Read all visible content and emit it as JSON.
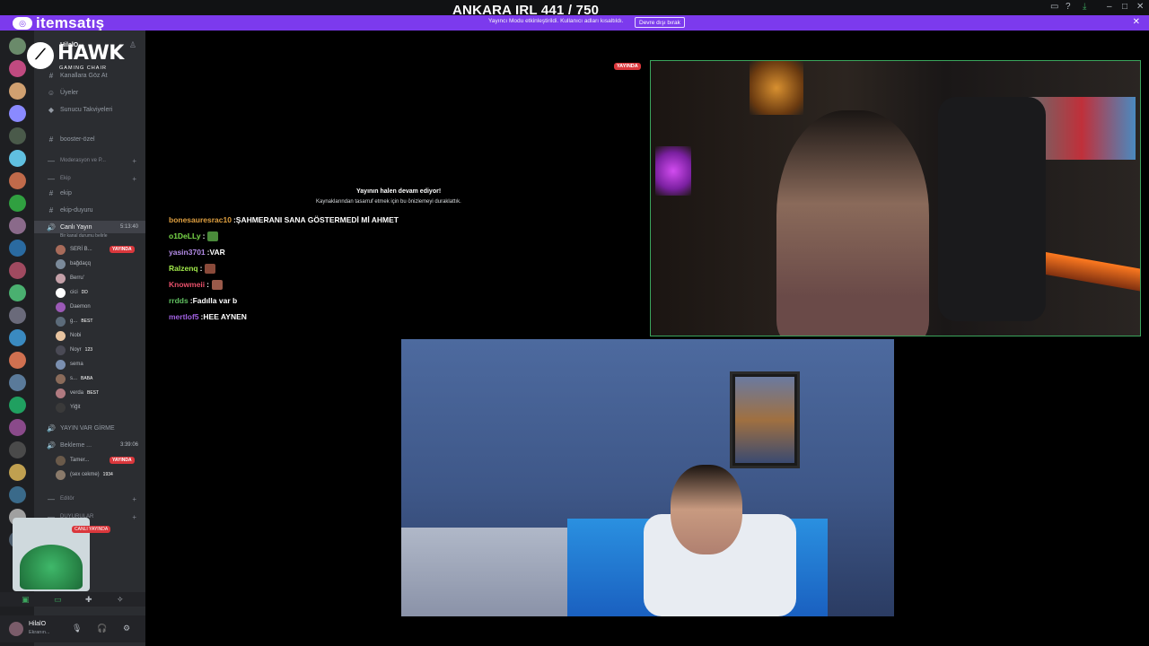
{
  "window": {
    "overlay_title": "ANKARA IRL 441 / 750"
  },
  "brand": {
    "name": "itemsatış"
  },
  "notice": {
    "text": "Yayıncı Modu etkinleştirildi. Kullanıcı adları kısaltıldı.",
    "disable_button": "Devre dışı bırak"
  },
  "sponsor": {
    "word": "HAWK",
    "sub": "GAMING CHAIR"
  },
  "sidebar": {
    "server_name": "HilalO ⌄",
    "items": [
      {
        "icon": "#",
        "label": "Kanallara Göz At"
      },
      {
        "icon": "👥",
        "label": "Üyeler"
      },
      {
        "icon": "◆",
        "label": "Sunucu Takviyeleri"
      },
      {
        "icon": "#",
        "label": "booster-özel"
      }
    ],
    "categories": [
      {
        "label": "Moderasyon ve P..."
      },
      {
        "label": "Ekip"
      }
    ],
    "channels": [
      {
        "icon": "#",
        "label": "ekip"
      },
      {
        "icon": "#",
        "label": "ekip-duyuru"
      }
    ],
    "voice_live": {
      "label": "Canlı Yayın",
      "time": "5:13:40",
      "subtitle": "Bir kanal durumu belirle"
    },
    "members_live": [
      {
        "name": "SERİ B...",
        "badge": "YAYINDA",
        "color": "#a86b5a"
      },
      {
        "name": "bağdaçq",
        "color": "#7b8a9a"
      },
      {
        "name": "Berru'",
        "color": "#c4a0a8"
      },
      {
        "name": "cici",
        "tag": "DD",
        "color": "#fff"
      },
      {
        "name": "Daemon",
        "color": "#9b59b6"
      },
      {
        "name": "g...",
        "tag": "BEST",
        "color": "#5c6b7a"
      },
      {
        "name": "Nobi",
        "color": "#e8c4a0"
      },
      {
        "name": "Noyr",
        "tag": "123",
        "color": "#4a4a55"
      },
      {
        "name": "sema",
        "color": "#7a8fb0"
      },
      {
        "name": "s...",
        "tag": "BABA",
        "color": "#8a6b5a"
      },
      {
        "name": "verda",
        "tag": "BEST",
        "color": "#b07a80"
      },
      {
        "name": "Yiğit",
        "color": "#3a3a3a"
      }
    ],
    "category_yayin": "YAYIN VAR GİRME",
    "voice_wait": {
      "label": "Bekleme ...",
      "time": "3:39:06"
    },
    "members_wait": [
      {
        "name": "Tamer...",
        "badge": "YAYINDA",
        "color": "#6a5a4a"
      },
      {
        "name": "(sex cekme)",
        "tag": "1934",
        "color": "#8a7a6a"
      }
    ],
    "category_editor": "Editör",
    "category_duyuru": "DUYURULAR",
    "pip_badge": "CANLI YAYINDA",
    "user": {
      "name": "HilalO",
      "status": "Ekranın..."
    }
  },
  "stream": {
    "live_badge": "YAYINDA",
    "paused_title": "Yayının halen devam ediyor!",
    "paused_sub": "Kaynaklarından tasarruf etmek için bu önizlemeyi duraklattık."
  },
  "chat": [
    {
      "user": "bonesauresrac10",
      "color": "#e0a040",
      "msg": "ŞAHMERANI SANA GÖSTERMEDİ Mİ AHMET"
    },
    {
      "user": "o1DeLLy",
      "color": "#7bdc4a",
      "msg": "",
      "emote": "#4a8a3a"
    },
    {
      "user": "yasin3701",
      "color": "#b48ce8",
      "msg": "VAR"
    },
    {
      "user": "Ralzenq",
      "color": "#a0e84a",
      "msg": "",
      "emote": "#8a4a3a"
    },
    {
      "user": "Knowmeii",
      "color": "#e8506a",
      "msg": "",
      "emote": "#9a5a4a"
    },
    {
      "user": "rrdds",
      "color": "#60c060",
      "msg": "Fadılla var b"
    },
    {
      "user": "mertlof5",
      "color": "#a060e0",
      "msg": "HEE AYNEN"
    }
  ]
}
